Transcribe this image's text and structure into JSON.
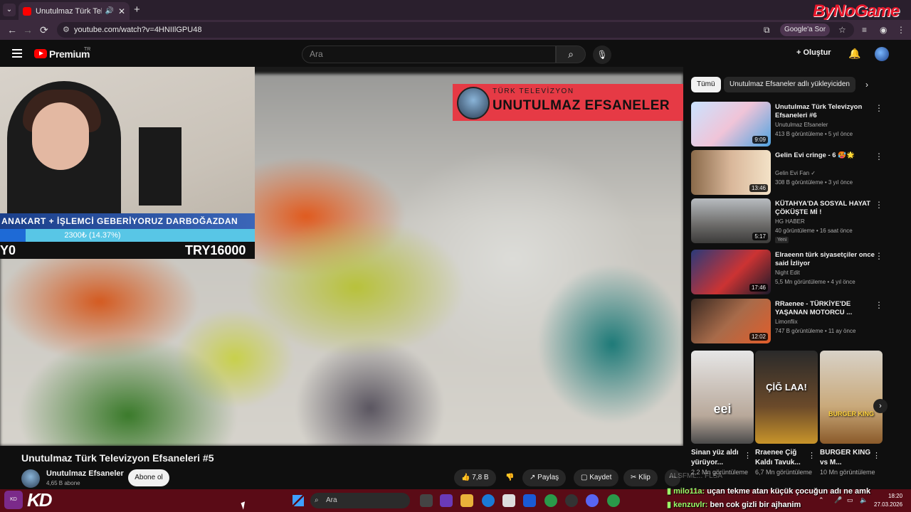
{
  "browser": {
    "tab_title": "Unutulmaz Türk Televizyon",
    "tab_speaker": "🔊",
    "tab_close": "✕",
    "new_tab": "+",
    "tab_menu": "⌄",
    "back": "←",
    "forward": "→",
    "reload": "⟳",
    "url": "youtube.com/watch?v=4HNIIlGPU48",
    "google_sor": "Google'a Sor",
    "watermark": "ByNoGame"
  },
  "youtube": {
    "logo_text": "Premium",
    "region": "TR",
    "search_placeholder": "Ara",
    "search_icon": "⌕",
    "mic_icon": "🎙",
    "create_label": "+ Oluştur",
    "bell_icon": "🔔"
  },
  "video": {
    "overlay_small": "TÜRK TELEVİZYON",
    "overlay_big": "UNUTULMAZ EFSANELER",
    "title": "Unutulmaz Türk Televizyon Efsaneleri #5",
    "channel": "Unutulmaz Efsaneler",
    "subscribers": "4,65 B abone",
    "subscribe_label": "Abone ol",
    "likes": "👍 7,8 B",
    "dislike": "👎",
    "share": "↗ Paylaş",
    "save": "▢ Kaydet",
    "clip": "✂ Klip",
    "more": "⋯"
  },
  "webcam": {
    "ticker": "ANAKART + İŞLEMCİ GEBERİYORUZ DARBOĞAZDAN",
    "progress_text": "2300₺ (14.37%)",
    "progress_fraction": 0.1437,
    "left_num": "Y0",
    "right_num": "TRY16000"
  },
  "sidebar": {
    "chips": [
      "Tümü",
      "Unutulmaz Efsaneler adlı yükleyiciden"
    ],
    "chip_next": "›",
    "recommendations": [
      {
        "title": "Unutulmaz Türk Televizyon Efsaneleri #6",
        "channel": "Unutulmaz Efsaneler",
        "meta": "413 B görüntüleme • 5 yıl önce",
        "duration": "9:09",
        "badge": ""
      },
      {
        "title": "Gelin Evi cringe - 6 🥵🌟",
        "channel": "Gelin Evi Fan ✓",
        "meta": "308 B görüntüleme • 3 yıl önce",
        "duration": "13:46",
        "badge": ""
      },
      {
        "title": "KÜTAHYA'DA SOSYAL HAYAT ÇÖKÜŞTE Mİ !",
        "channel": "HG HABER",
        "meta": "40 görüntüleme • 16 saat önce",
        "duration": "5:17",
        "badge": "Yeni"
      },
      {
        "title": "Elraeenn türk siyasetçiler once said İzliyor",
        "channel": "Night Edit",
        "meta": "5,5 Mn görüntüleme • 4 yıl önce",
        "duration": "17:46",
        "badge": ""
      },
      {
        "title": "RRaenee - TÜRKİYE'DE YAŞANAN MOTORCU ...",
        "channel": "Limonflix",
        "meta": "747 B görüntüleme • 11 ay önce",
        "duration": "12:02",
        "badge": ""
      }
    ],
    "shorts": [
      {
        "title": "Sinan yüz aldı yürüyor...",
        "views": "2,2 Mn görüntüleme",
        "thumb_text": "eei"
      },
      {
        "title": "Rraenee Çiğ Kaldı Tavuk...",
        "views": "6,7 Mn görüntüleme",
        "thumb_text": "ÇİĞ LAA!"
      },
      {
        "title": "BURGER KING vs M...",
        "views": "10 Mn görüntüleme",
        "thumb_text": "BURGER KING"
      }
    ],
    "shorts_next": "›",
    "menu_dots": "⋮"
  },
  "chat": {
    "ghost": "ALSFML... FLSA",
    "lines": [
      {
        "user": "milo11a:",
        "msg": " uçan tekme atan küçük çocuğun adı ne amk"
      },
      {
        "user": "kenzuvlr:",
        "msg": " ben cok gizli bir ajhanim"
      }
    ]
  },
  "taskbar": {
    "stream_logo": "KD",
    "kd": "KD",
    "search_placeholder": "Ara",
    "search_icon": "⌕",
    "time": "18:20",
    "date": "27.03.2026",
    "tray_up": "⌃"
  },
  "colors": {
    "youtube_red": "#ff0000",
    "banner_red": "#e63a45",
    "taskbar": "#5a0b16",
    "chat_user": "#9bff6a"
  }
}
